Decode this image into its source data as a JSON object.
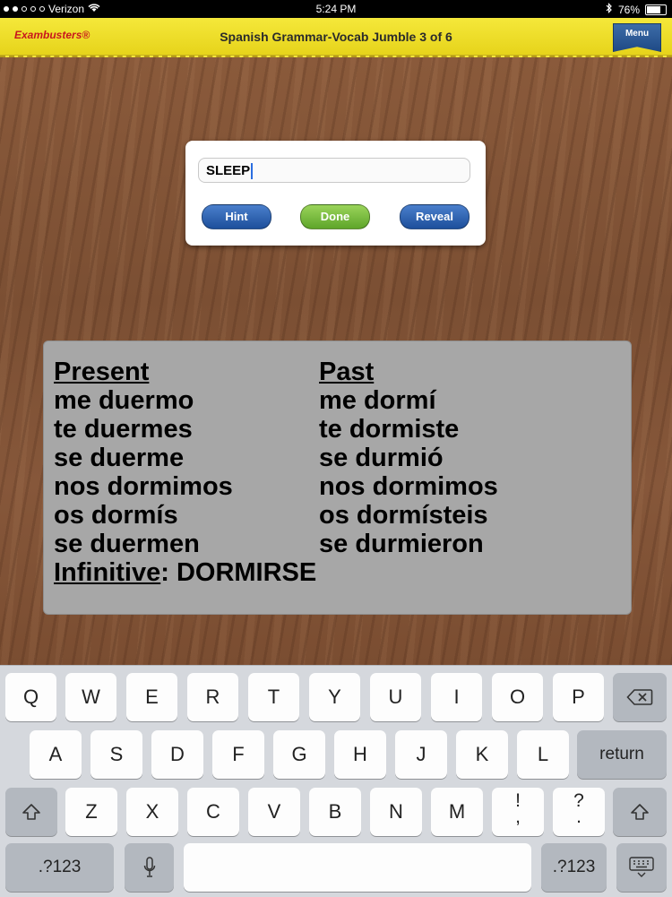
{
  "status": {
    "carrier": "Verizon",
    "time": "5:24 PM",
    "battery": "76%",
    "battery_level": 0.76
  },
  "header": {
    "logo": "Exambusters®",
    "title": "Spanish Grammar-Vocab Jumble 3 of 6",
    "menu": "Menu"
  },
  "panel": {
    "answer_value": "SLEEP",
    "hint": "Hint",
    "done": "Done",
    "reveal": "Reveal"
  },
  "card": {
    "present_header": "Present",
    "past_header": "Past",
    "present": [
      "me duermo",
      "te duermes",
      "se duerme",
      "nos dormimos",
      "os dormís",
      "se duermen"
    ],
    "past": [
      "me dormí",
      "te dormiste",
      "se durmió",
      "nos dormimos",
      "os dormísteis",
      "se durmieron"
    ],
    "infinitive_label": "Infinitive",
    "infinitive_value": ": DORMIRSE"
  },
  "keyboard": {
    "row1": [
      "Q",
      "W",
      "E",
      "R",
      "T",
      "Y",
      "U",
      "I",
      "O",
      "P"
    ],
    "row2": [
      "A",
      "S",
      "D",
      "F",
      "G",
      "H",
      "J",
      "K",
      "L"
    ],
    "row3": [
      "Z",
      "X",
      "C",
      "V",
      "B",
      "N",
      "M"
    ],
    "return": "return",
    "numbers": ".?123",
    "excl": [
      "!",
      ","
    ],
    "quest": [
      "?",
      "."
    ]
  },
  "colors": {
    "header_yellow": "#e6d31a",
    "menu_blue": "#1f4a86",
    "done_green": "#5ea52a",
    "card_gray": "#a7a7a7"
  }
}
